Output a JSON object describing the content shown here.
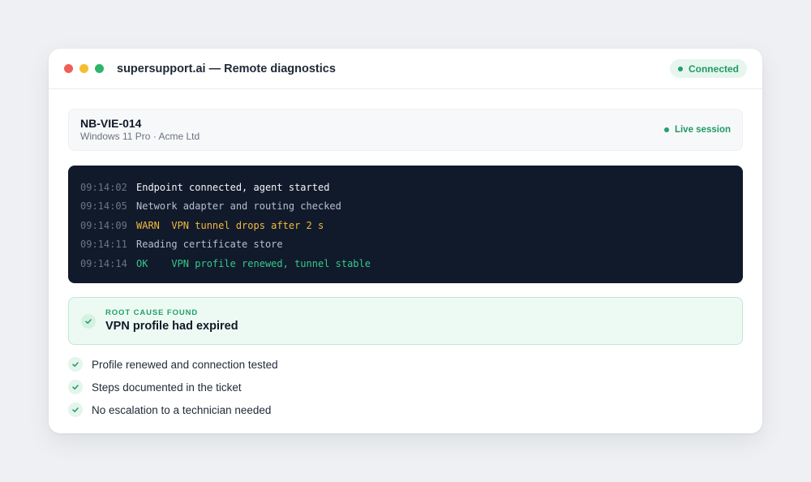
{
  "colors": {
    "dot_red": "#ef5f57",
    "dot_yellow": "#f6bd2f",
    "dot_green": "#2bb66a",
    "accent_green": "#22a06b",
    "warn": "#f2b93b",
    "ok": "#34c98a",
    "terminal_bg": "#111a2b"
  },
  "window": {
    "title": "supersupport.ai — Remote diagnostics",
    "status": "Connected"
  },
  "device": {
    "name": "NB-VIE-014",
    "subtitle": "Windows 11 Pro · Acme Ltd",
    "session_status": "Live session"
  },
  "log": [
    {
      "time": "09:14:02",
      "message": "Endpoint connected, agent started",
      "level": "info-bright"
    },
    {
      "time": "09:14:05",
      "message": "Network adapter and routing checked",
      "level": "info"
    },
    {
      "time": "09:14:09",
      "message": "WARN  VPN tunnel drops after 2 s",
      "level": "warn"
    },
    {
      "time": "09:14:11",
      "message": "Reading certificate store",
      "level": "info"
    },
    {
      "time": "09:14:14",
      "message": "OK    VPN profile renewed, tunnel stable",
      "level": "ok"
    }
  ],
  "root_cause": {
    "label": "ROOT CAUSE FOUND",
    "title": "VPN profile had expired",
    "icon": "check-icon"
  },
  "steps": [
    {
      "text": "Profile renewed and connection tested",
      "icon": "check-icon"
    },
    {
      "text": "Steps documented in the ticket",
      "icon": "check-icon"
    },
    {
      "text": "No escalation to a technician needed",
      "icon": "check-icon"
    }
  ]
}
